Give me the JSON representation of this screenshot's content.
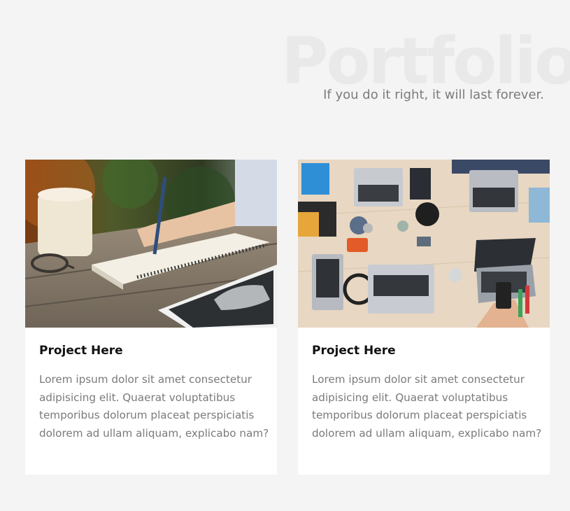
{
  "header": {
    "watermark": "Portfolio",
    "subtitle": "If you do it right, it will last forever."
  },
  "projects": [
    {
      "title": "Project Here",
      "description": "Lorem ipsum dolor sit amet consectetur adipisicing elit. Quaerat voluptatibus temporibus dolorum placeat perspiciatis dolorem ad ullam aliquam, explicabo nam?",
      "image": "person-writing-notebook-photo"
    },
    {
      "title": "Project Here",
      "description": "Lorem ipsum dolor sit amet consectetur adipisicing elit. Quaerat voluptatibus temporibus dolorum placeat perspiciatis dolorem ad ullam aliquam, explicabo nam?",
      "image": "team-laptops-desk-photo"
    }
  ]
}
